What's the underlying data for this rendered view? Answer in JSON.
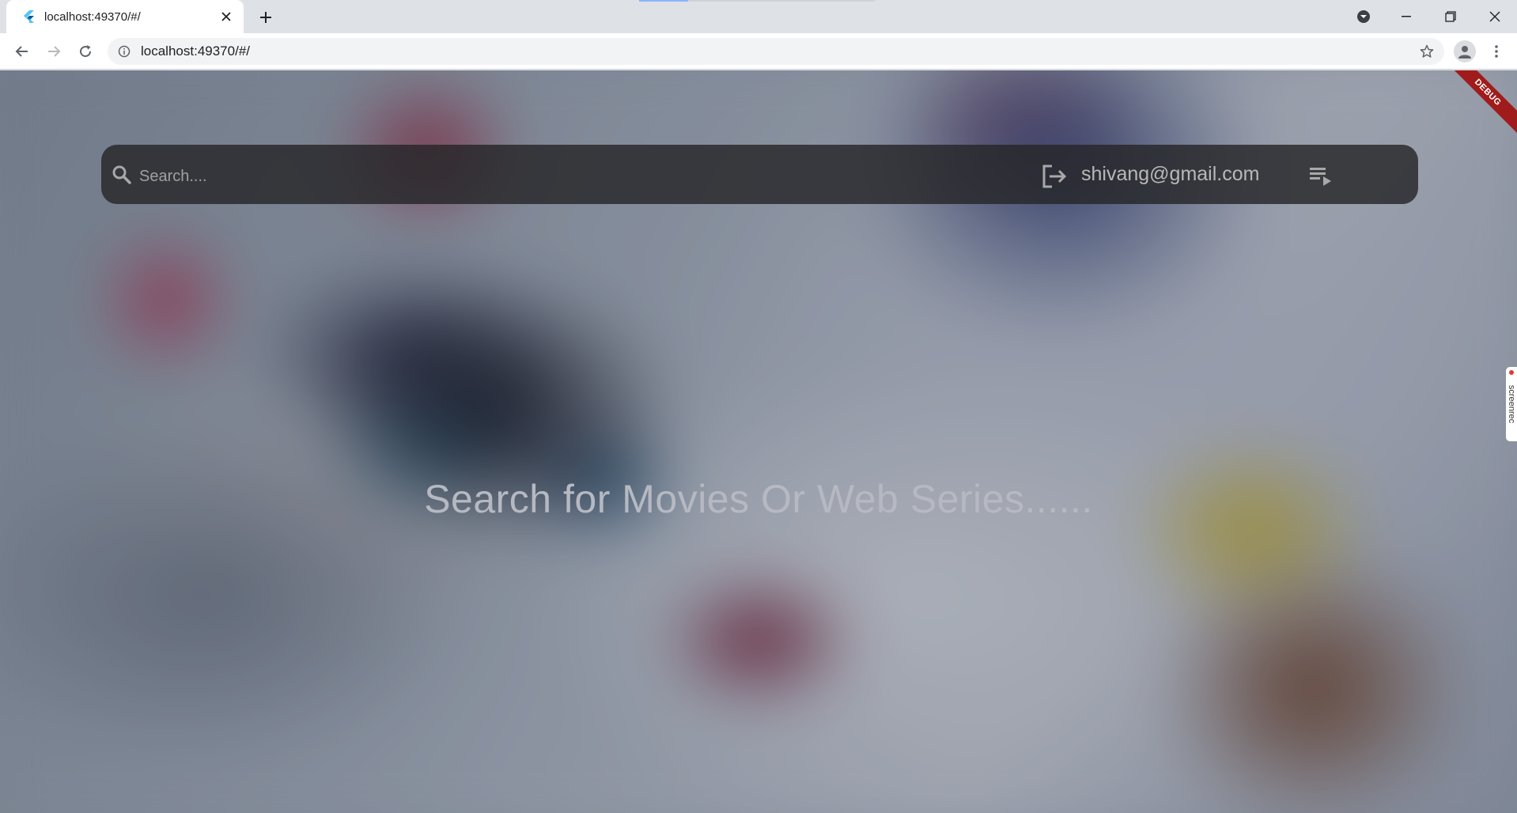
{
  "browser": {
    "tab_title": "localhost:49370/#/",
    "url": "localhost:49370/#/"
  },
  "search": {
    "placeholder": "Search...."
  },
  "user": {
    "email": "shivang@gmail.com"
  },
  "main": {
    "prompt": "Search for Movies Or Web Series......"
  },
  "badges": {
    "debug": "DEBUG",
    "screenrec": "screenrec"
  },
  "icons": {
    "favicon": "flutter-icon",
    "search": "search-icon",
    "logout": "logout-icon",
    "playlist": "playlist-play-icon"
  },
  "colors": {
    "searchbar_bg": "#262628",
    "prompt_text": "#b6b9c2",
    "debug_ribbon": "#a01c1c",
    "caret": "#4a90e2"
  }
}
